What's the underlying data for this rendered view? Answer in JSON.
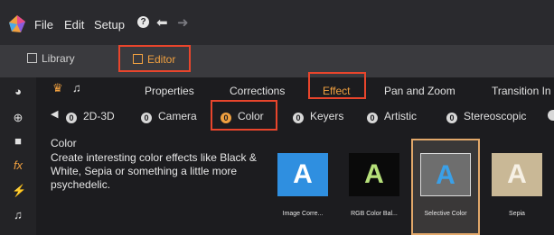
{
  "menu": {
    "file": "File",
    "edit": "Edit",
    "setup": "Setup",
    "help_icon": "question-icon",
    "undo_icon": "undo-icon",
    "redo_icon": "redo-icon"
  },
  "tabs": {
    "library": "Library",
    "editor": "Editor"
  },
  "categories": [
    "Properties",
    "Corrections",
    "Effect",
    "Pan and Zoom",
    "Transition In"
  ],
  "subcategories": [
    {
      "num": "0",
      "label": "2D-3D"
    },
    {
      "num": "0",
      "label": "Camera"
    },
    {
      "num": "0",
      "label": "Color"
    },
    {
      "num": "0",
      "label": "Keyers"
    },
    {
      "num": "0",
      "label": "Artistic"
    },
    {
      "num": "0",
      "label": "Stereoscopic"
    }
  ],
  "description": {
    "title": "Color",
    "text": "Create interesting color effects like Black & White, Sepia or something a little more psychedelic."
  },
  "thumbnails": [
    {
      "label": "Image Corre...",
      "letter": "A",
      "bg": "#2f8fe0",
      "fg": "#ffffff"
    },
    {
      "label": "RGB Color Bal...",
      "letter": "A",
      "bg": "#0a0a0a",
      "fg": "#b6e07a"
    },
    {
      "label": "Selective Color",
      "letter": "A",
      "bg": "#6e6e6e",
      "fg": "#3aa0e8"
    },
    {
      "label": "Sepia",
      "letter": "A",
      "bg": "#c9b896",
      "fg": "#f6f0e4"
    }
  ],
  "colors": {
    "highlight": "#e8452c",
    "accent": "#f0a040"
  }
}
